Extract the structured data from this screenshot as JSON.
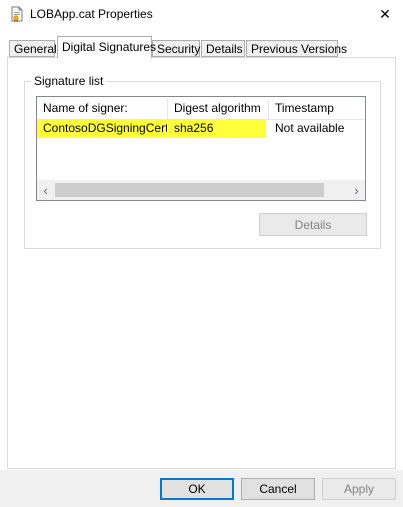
{
  "window": {
    "title": "LOBApp.cat Properties",
    "close_glyph": "✕"
  },
  "tabs": [
    {
      "label": "General"
    },
    {
      "label": "Digital Signatures"
    },
    {
      "label": "Security"
    },
    {
      "label": "Details"
    },
    {
      "label": "Previous Versions"
    }
  ],
  "active_tab": "Digital Signatures",
  "signature_list": {
    "group_label": "Signature list",
    "columns": [
      "Name of signer:",
      "Digest algorithm",
      "Timestamp"
    ],
    "rows": [
      {
        "signer": "ContosoDGSigningCert",
        "digest": "sha256",
        "timestamp": "Not available",
        "highlight_color": "#ffff3a"
      }
    ],
    "scroll_left": "‹",
    "scroll_right": "›"
  },
  "details_button": {
    "label": "Details",
    "enabled": false
  },
  "footer": {
    "ok_label": "OK",
    "cancel_label": "Cancel",
    "apply_label": "Apply",
    "apply_enabled": false
  },
  "colors": {
    "accent": "#0078d7",
    "highlight": "#ffff3a"
  }
}
